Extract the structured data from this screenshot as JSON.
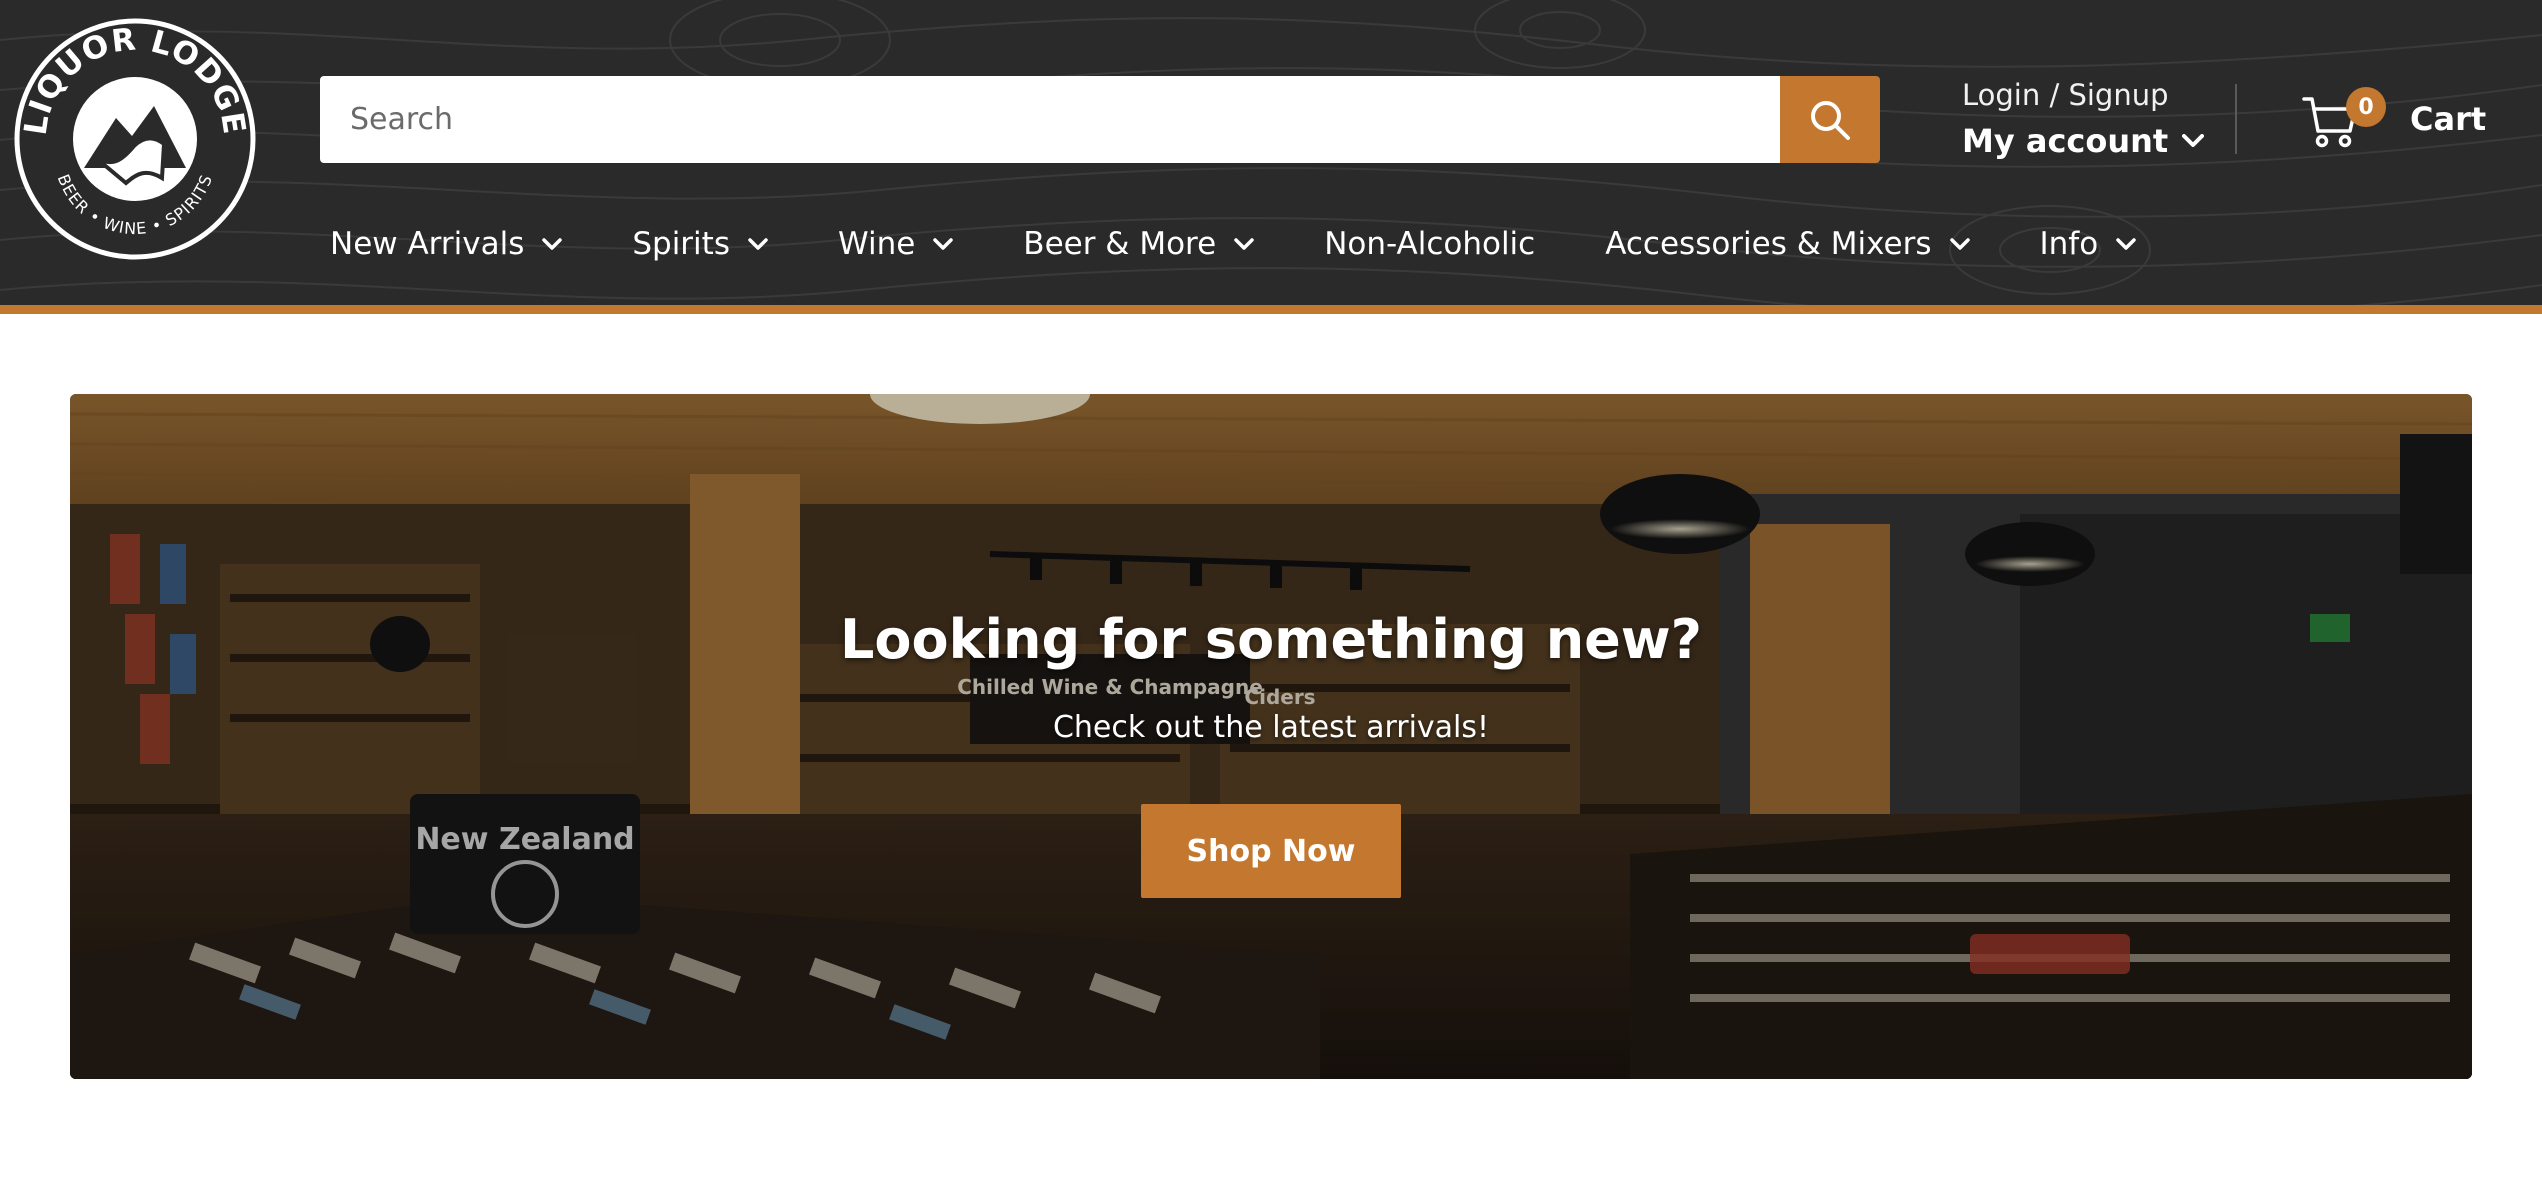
{
  "brand": {
    "logo_text_top": "LIQUOR LODGE",
    "logo_text_bottom": "BEER • WINE • SPIRITS"
  },
  "search": {
    "placeholder": "Search",
    "icon": "search-icon"
  },
  "account": {
    "login_label": "Login / Signup",
    "my_account_label": "My account"
  },
  "cart": {
    "count": "0",
    "label": "Cart",
    "icon": "cart-icon"
  },
  "nav": {
    "items": [
      {
        "label": "New Arrivals",
        "has_dropdown": true
      },
      {
        "label": "Spirits",
        "has_dropdown": true
      },
      {
        "label": "Wine",
        "has_dropdown": true
      },
      {
        "label": "Beer & More",
        "has_dropdown": true
      },
      {
        "label": "Non-Alcoholic",
        "has_dropdown": false
      },
      {
        "label": "Accessories & Mixers",
        "has_dropdown": true
      },
      {
        "label": "Info",
        "has_dropdown": true
      }
    ]
  },
  "hero": {
    "title": "Looking for something new?",
    "subtitle": "Check out the latest arrivals!",
    "button_label": "Shop Now",
    "sign_left": "New Zealand",
    "sign_center": "Chilled Wine & Champagne",
    "sign_ciders": "Ciders"
  },
  "colors": {
    "header_bg": "#2a2a2a",
    "accent": "#c4782f",
    "text": "#ffffff"
  }
}
